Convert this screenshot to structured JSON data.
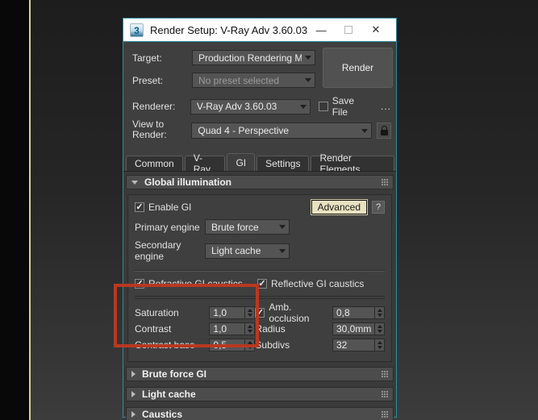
{
  "window": {
    "app_icon_glyph": "3",
    "title": "Render Setup: V-Ray Adv 3.60.03",
    "minimize_glyph": "—",
    "close_glyph": "✕"
  },
  "toolbar": {
    "target_label": "Target:",
    "target_value": "Production Rendering Mode",
    "preset_label": "Preset:",
    "preset_value": "No preset selected",
    "renderer_label": "Renderer:",
    "renderer_value": "V-Ray Adv 3.60.03",
    "render_button": "Render",
    "save_file_label": "Save File",
    "browse_label": "...",
    "view_label": "View to Render:",
    "view_value": "Quad 4 - Perspective"
  },
  "tabs": [
    {
      "label": "Common"
    },
    {
      "label": "V-Ray"
    },
    {
      "label": "GI"
    },
    {
      "label": "Settings"
    },
    {
      "label": "Render Elements"
    }
  ],
  "gi": {
    "rollout_title": "Global illumination",
    "enable_gi_label": "Enable GI",
    "advanced_button": "Advanced",
    "help_button": "?",
    "primary_label": "Primary engine",
    "primary_value": "Brute force",
    "secondary_label": "Secondary engine",
    "secondary_value": "Light cache",
    "refractive_label": "Refractive GI caustics",
    "reflective_label": "Reflective GI caustics",
    "saturation_label": "Saturation",
    "saturation_value": "1,0",
    "contrast_label": "Contrast",
    "contrast_value": "1,0",
    "contrast_base_label": "Contrast base",
    "contrast_base_value": "0,5",
    "ao_label": "Amb. occlusion",
    "ao_value": "0,8",
    "radius_label": "Radius",
    "radius_value": "30,0mm",
    "subdivs_label": "Subdivs",
    "subdivs_value": "32"
  },
  "rollouts": [
    {
      "title": "Brute force GI"
    },
    {
      "title": "Light cache"
    },
    {
      "title": "Caustics"
    }
  ],
  "colors": {
    "dialog_border": "#2e8c9e",
    "accent_line": "#d6d28e",
    "highlight": "#b93822",
    "advanced_button_bg": "#e9e2c0",
    "titlebar_bg": "#ffffff",
    "dialog_bg": "#3f3f3f"
  }
}
